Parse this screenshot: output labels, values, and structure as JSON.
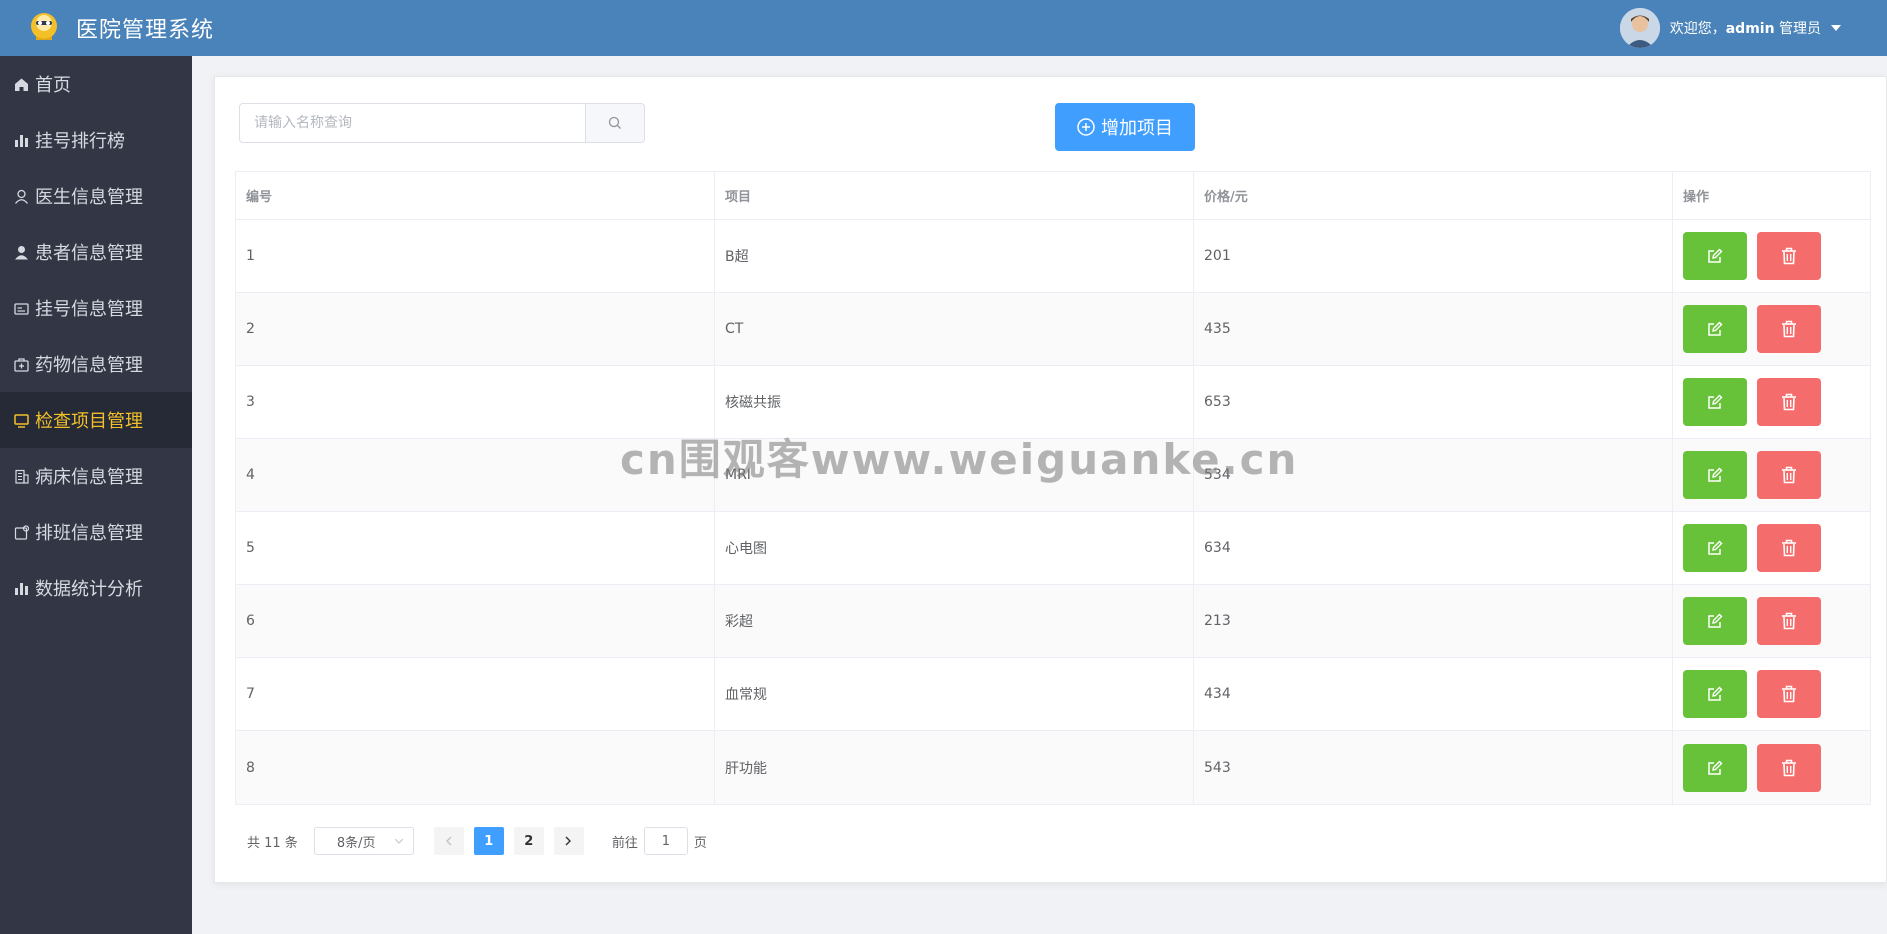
{
  "header": {
    "app_title": "医院管理系统",
    "welcome_prefix": "欢迎您，",
    "username": "admin",
    "role": "管理员",
    "bg_color": "#4a83b9"
  },
  "sidebar": {
    "items": [
      {
        "label": "首页",
        "icon": "home-icon"
      },
      {
        "label": "挂号排行榜",
        "icon": "bar-chart-icon"
      },
      {
        "label": "医生信息管理",
        "icon": "user-icon"
      },
      {
        "label": "患者信息管理",
        "icon": "person-filled-icon"
      },
      {
        "label": "挂号信息管理",
        "icon": "id-card-icon"
      },
      {
        "label": "药物信息管理",
        "icon": "first-aid-kit-icon"
      },
      {
        "label": "检查项目管理",
        "icon": "monitor-icon",
        "active": true
      },
      {
        "label": "病床信息管理",
        "icon": "building-icon"
      },
      {
        "label": "排班信息管理",
        "icon": "calendar-icon"
      },
      {
        "label": "数据统计分析",
        "icon": "bar-chart-icon"
      }
    ],
    "active_color": "#f4c02a"
  },
  "search": {
    "placeholder": "请输入名称查询",
    "value": ""
  },
  "toolbar": {
    "add_label": "增加项目"
  },
  "table": {
    "headers": [
      "编号",
      "项目",
      "价格/元",
      "操作"
    ],
    "rows": [
      {
        "id": "1",
        "name": "B超",
        "price": "201"
      },
      {
        "id": "2",
        "name": "CT",
        "price": "435"
      },
      {
        "id": "3",
        "name": "核磁共振",
        "price": "653"
      },
      {
        "id": "4",
        "name": "MRI",
        "price": "534"
      },
      {
        "id": "5",
        "name": "心电图",
        "price": "634"
      },
      {
        "id": "6",
        "name": "彩超",
        "price": "213"
      },
      {
        "id": "7",
        "name": "血常规",
        "price": "434"
      },
      {
        "id": "8",
        "name": "肝功能",
        "price": "543"
      }
    ]
  },
  "pagination": {
    "total_text": "共 11 条",
    "page_size": "8条/页",
    "pages": [
      "1",
      "2"
    ],
    "current_page": "1",
    "goto_label": "前往",
    "goto_value": "1",
    "page_suffix": "页"
  },
  "watermark": "cn围观客www.weiguanke.cn"
}
